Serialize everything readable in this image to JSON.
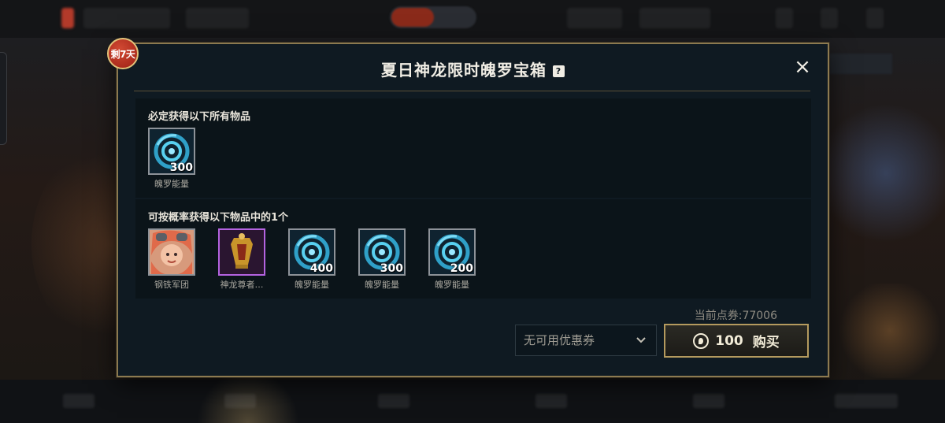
{
  "badge": {
    "text": "剩7天"
  },
  "modal": {
    "title": "夏日神龙限时魄罗宝箱",
    "help_icon": "?",
    "close_icon": "×"
  },
  "guaranteed": {
    "label": "必定获得以下所有物品",
    "items": [
      {
        "name": "魄罗能量",
        "qty": "300",
        "icon": "poro-energy-icon"
      }
    ]
  },
  "random": {
    "label": "可按概率获得以下物品中的1个",
    "items": [
      {
        "name": "钢铁军团",
        "qty": "",
        "icon": "champion-portrait-icon"
      },
      {
        "name": "神龙尊者…",
        "qty": "",
        "icon": "dragon-emblem-icon"
      },
      {
        "name": "魄罗能量",
        "qty": "400",
        "icon": "poro-energy-icon"
      },
      {
        "name": "魄罗能量",
        "qty": "300",
        "icon": "poro-energy-icon"
      },
      {
        "name": "魄罗能量",
        "qty": "200",
        "icon": "poro-energy-icon"
      }
    ]
  },
  "footer": {
    "points": "当前点券:77006",
    "coupon": "无可用优惠券",
    "price": "100",
    "buy_label": "购买"
  },
  "colors": {
    "accent_gold": "#b49a5e",
    "badge_red": "#b3271b",
    "purple_frame": "#b463e0"
  }
}
